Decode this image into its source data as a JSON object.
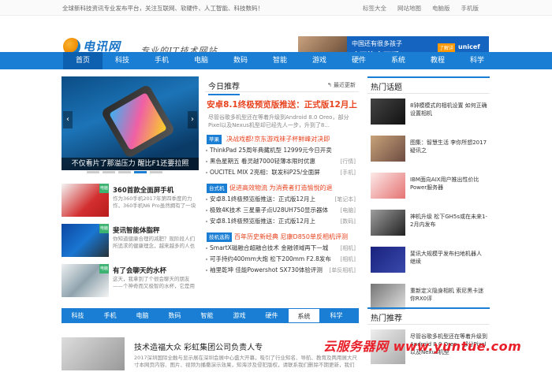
{
  "topbar": {
    "slogan": "全球新科技资讯专业发布平台，关注互联网、软硬件、人工智能、科技数码！",
    "links": [
      "标签大全",
      "网站地图",
      "电脑版",
      "手机版"
    ]
  },
  "logo": {
    "name": "电讯网",
    "pinyin": "xiuzhanwang"
  },
  "tagline": "专业的IT技术网站",
  "ad": {
    "line1": "中国还有很多孩子",
    "line2": "吃不饱穿不暖",
    "button": "了解详情",
    "brand": "unicef"
  },
  "nav": {
    "items": [
      "首页",
      "科技",
      "手机",
      "电脑",
      "数码",
      "智能",
      "游戏",
      "硬件",
      "系统",
      "教程",
      "科学"
    ]
  },
  "slider": {
    "caption": "不仅看片了那溢压力 醒比F1还要拉照",
    "prev": "‹",
    "next": "›"
  },
  "stories": [
    {
      "title": "360首款全面屏手机",
      "desc": "作为360手机2017年第四季度的力作，360手机N6 Pro虽然拥有了一块",
      "tag": "电脑"
    },
    {
      "title": "斐讯智能体脂秤",
      "desc": "你知道健康合理的减肥？现阶段人们所追求的健康理念，越来越多的人也意",
      "tag": "电脑"
    },
    {
      "title": "有了会聊天的水杯",
      "desc": "这天，我拿到了个很会聊天的朋友——个神奇而又极智的水杯，它是用时好",
      "tag": "电脑"
    }
  ],
  "mid": {
    "title": "今日推荐",
    "refresh": "最近更新",
    "headline": "安卓8.1终极预览版推送：正式版12月上",
    "headline_desc": "尽管谷歌多机型还在等着升级到Android 8.0 Oreo，部分Pixel以及Nexus机型却已经先人一步，升到了8...",
    "groups": [
      {
        "label": "苹果",
        "title": "决战戏都!京东游戏袜子杯鲜峰对决即",
        "items": [
          {
            "text": "ThinkPad 25周年典藏机型 12999元今日开卖",
            "tag": ""
          },
          {
            "text": "黑色星期五 看灵越7000轻薄本限时优惠",
            "tag": "[行情]"
          },
          {
            "text": "OUCITEL MIX 2亮相：联发科P25/全面屏",
            "tag": "[手机]"
          }
        ]
      },
      {
        "label": "台式机",
        "title": "促进高效物流 为消费者打造愉悦的退",
        "items": [
          {
            "text": "安卓8.1终极预览版推送：正式版12月上",
            "tag": "[笔记本]"
          },
          {
            "text": "极致4K技术 三星量子点U28UH750显示器体",
            "tag": "[电脑]"
          },
          {
            "text": "安卓8.1终极预览版推送：正式版12月上",
            "tag": "[数码]"
          }
        ]
      },
      {
        "label": "技机选购",
        "title": "百年历史新经典 尼康D850单反相机评测",
        "items": [
          {
            "text": "SmartX磁融合超融合技术 金融领域再下一城",
            "tag": "[相机]"
          },
          {
            "text": "可手持约400mm大炮 松下200mm F2.8发布",
            "tag": "[相机]"
          },
          {
            "text": "袖里乾坤 佳能Powershot SX730体验评测",
            "tag": "[单反相机]"
          }
        ]
      }
    ]
  },
  "hot": {
    "title": "热门话题",
    "items": [
      "8钟模模式的相机设置 如何正确设置相机",
      "图集：智慧生活 李你所想2017疑讯之",
      "IBM面向AIX用户推出性价比Power服务器",
      "神机升级 松下GH5s或在未来1-2月内发布",
      "斐讯大规模乎发布扫地机器人 继续",
      "重新定义隐身相机 索尼黑卡迷你RX0评"
    ]
  },
  "tabs": {
    "items": [
      "科技",
      "手机",
      "电脑",
      "数码",
      "智能",
      "游戏",
      "硬件",
      "系统",
      "科学"
    ],
    "active": "系统"
  },
  "bottom_story": {
    "title": "技术造福大众 彩虹集团公司负责人专",
    "desc": "2017深圳国际全触与显示展在深圳会展中心盛大开幕，吸引了行业知名、导航、教育及两用展大尺寸本网页内容、图片、视频为播撒演示效果，知海涉及侵犯版权，请联系我们删除不期更新，我们将实在会进行更新..."
  },
  "recommend": {
    "title": "热门推荐",
    "item": "尽管谷歌多机型还在等着升级到Android 8.0 Oreo，部分Pixel以及Nexus机型"
  },
  "watermark": "云服务器网 www.yuntue.com"
}
